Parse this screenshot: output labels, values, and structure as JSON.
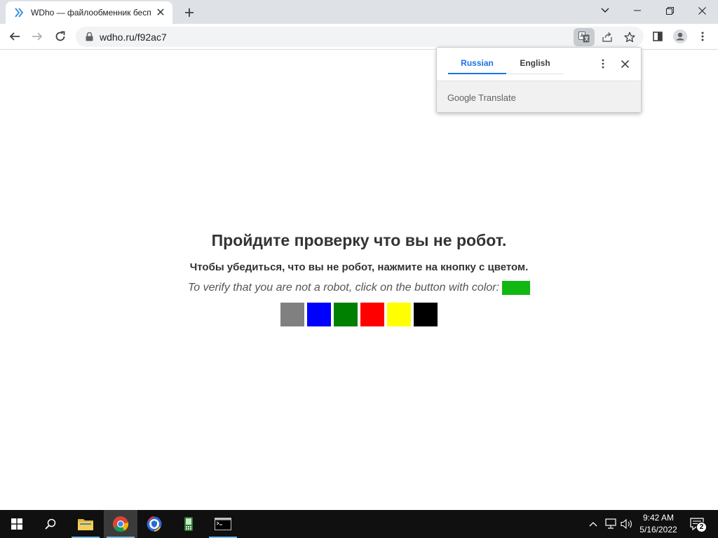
{
  "browser": {
    "tab": {
      "title": "WDho — файлообменник бесп",
      "close_glyph": "✕"
    },
    "new_tab_icon": "plus-icon",
    "omnibox": {
      "url": "wdho.ru/f92ac7"
    }
  },
  "translate_popup": {
    "tab_source": "Russian",
    "tab_target": "English",
    "brand_google": "Google",
    "brand_translate": "Translate"
  },
  "captcha": {
    "heading": "Пройдите проверку что вы не робот.",
    "instruction_ru": "Чтобы убедиться, что вы не робот, нажмите на кнопку с цветом.",
    "instruction_en": "To verify that you are not a robot, click on the button with color:",
    "target_color": "#12b812",
    "buttons": [
      {
        "name": "gray",
        "color": "#808080"
      },
      {
        "name": "blue",
        "color": "#0000ff"
      },
      {
        "name": "green",
        "color": "#008000"
      },
      {
        "name": "red",
        "color": "#ff0000"
      },
      {
        "name": "yellow",
        "color": "#ffff00"
      },
      {
        "name": "black",
        "color": "#000000"
      }
    ]
  },
  "taskbar": {
    "time": "9:42 AM",
    "date": "5/16/2022",
    "notification_count": "2"
  }
}
